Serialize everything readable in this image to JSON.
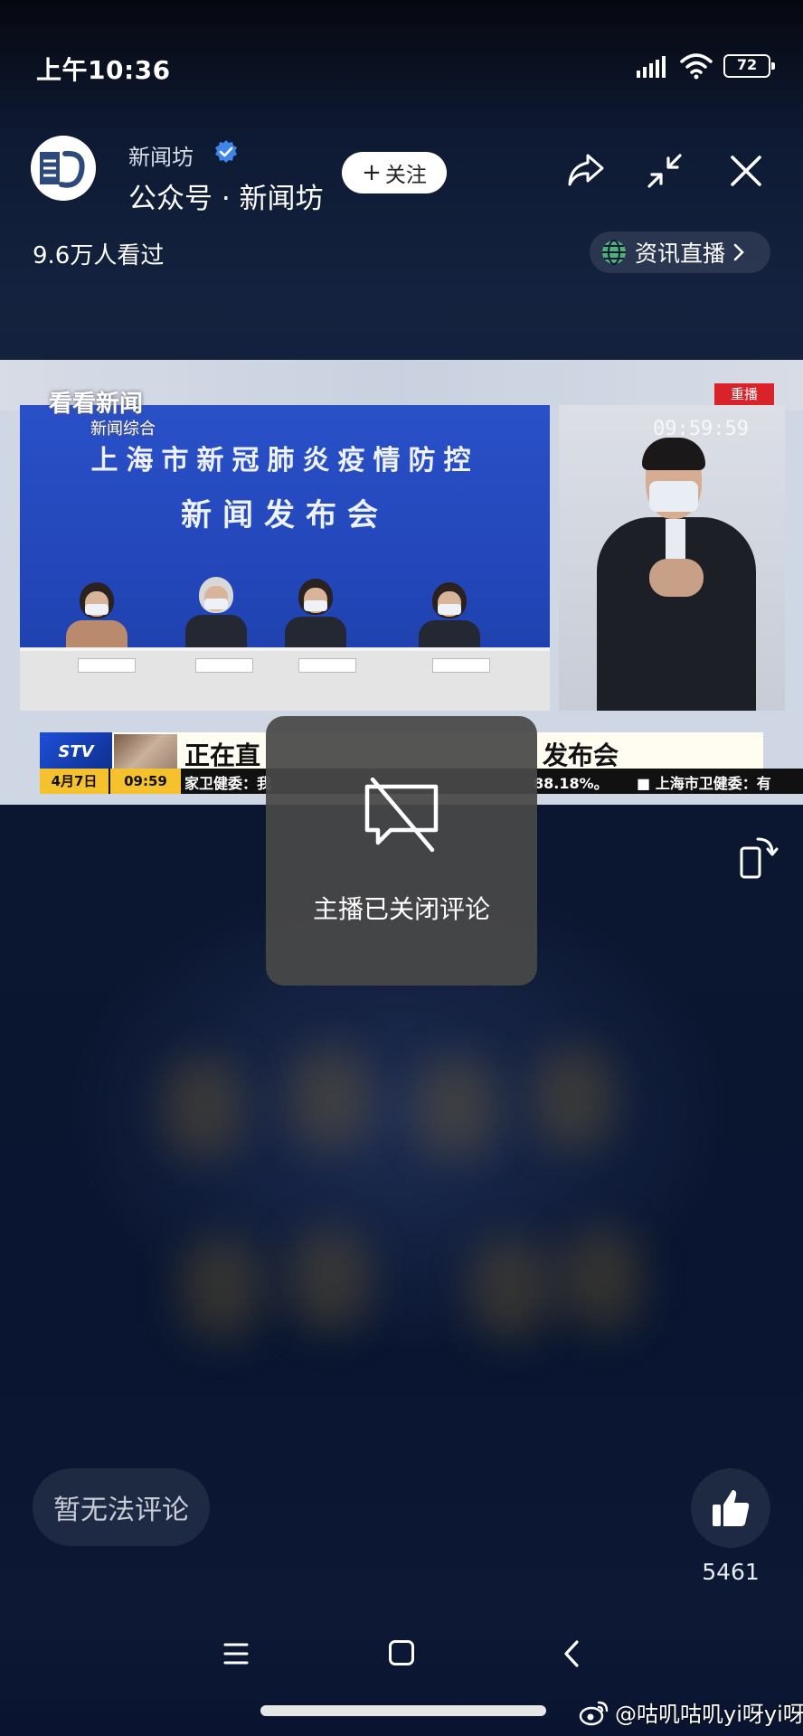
{
  "status_bar": {
    "time": "上午10:36",
    "battery": "72",
    "icons": [
      "signal-icon",
      "wifi-icon",
      "battery-icon"
    ]
  },
  "header": {
    "channel_name": "新闻坊",
    "account_line": "公众号 · 新闻坊",
    "follow_label": "关注",
    "viewers": "9.6万人看过",
    "news_live_label": "资讯直播",
    "icons": [
      "share-icon",
      "minimize-icon",
      "close-icon",
      "verified-icon",
      "globe-icon",
      "chevron-right-icon"
    ]
  },
  "video": {
    "watermark": "看看新闻",
    "watermark_sub": "新闻综合",
    "replay_badge": "重播",
    "backdrop_line1": "上海市新冠肺炎疫情防控",
    "backdrop_line2": "新闻发布会",
    "studio_clock": "09:59:59",
    "ticker": {
      "logo": "STV",
      "headline_a": "正在直",
      "headline_b": "发布会",
      "date": "4月7日",
      "clock": "09:59",
      "scroll_a": "家卫健委：我",
      "scroll_b": "88.18%。",
      "scroll_c": "■ 上海市卫健委：有"
    }
  },
  "overlay": {
    "message": "主播已关闭评论",
    "icon": "comment-disabled-icon"
  },
  "footer": {
    "comment_placeholder": "暂无法评论",
    "like_count": "5461",
    "icons": [
      "rotate-screen-icon",
      "thumbs-up-icon"
    ]
  },
  "navigation": {
    "icons": [
      "menu-icon",
      "home-icon",
      "back-icon"
    ]
  },
  "watermark": {
    "text": "@咕叽咕叽yi呀yi呀"
  },
  "colors": {
    "background": "#0c1834",
    "backdrop_blue": "#2246b8",
    "toast_bg": "#484848",
    "ticker_yellow": "#f5c22d",
    "replay_red": "#d9222a"
  }
}
